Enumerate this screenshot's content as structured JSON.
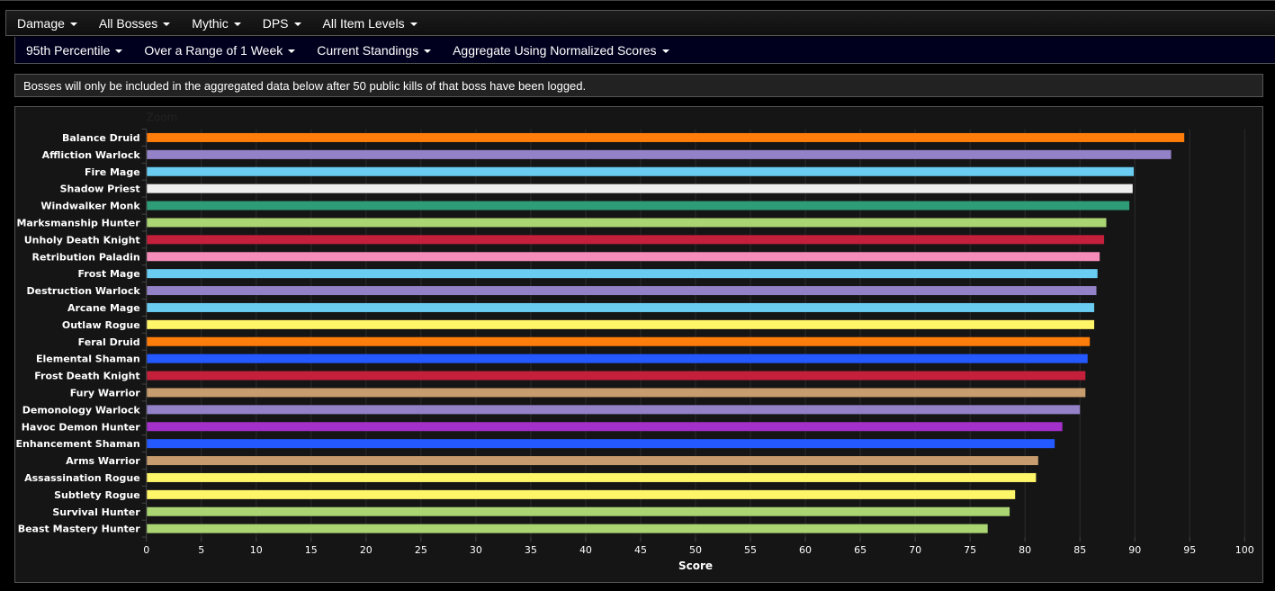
{
  "nav_primary": [
    {
      "label": "Damage"
    },
    {
      "label": "All Bosses"
    },
    {
      "label": "Mythic"
    },
    {
      "label": "DPS"
    },
    {
      "label": "All Item Levels"
    }
  ],
  "nav_secondary": [
    {
      "label": "95th Percentile"
    },
    {
      "label": "Over a Range of 1 Week"
    },
    {
      "label": "Current Standings"
    },
    {
      "label": "Aggregate Using Normalized Scores"
    }
  ],
  "info_message": "Bosses will only be included in the aggregated data below after 50 public kills of that boss have been logged.",
  "chart_data": {
    "type": "bar",
    "orientation": "horizontal",
    "zoom_label": "Zoom",
    "title": "",
    "xlabel": "Score",
    "ylabel": "",
    "xlim": [
      0,
      100
    ],
    "x_ticks": [
      0,
      5,
      10,
      15,
      20,
      25,
      30,
      35,
      40,
      45,
      50,
      55,
      60,
      65,
      70,
      75,
      80,
      85,
      90,
      95,
      100
    ],
    "grid": true,
    "legend": "none",
    "categories": [
      "Balance Druid",
      "Affliction Warlock",
      "Fire Mage",
      "Shadow Priest",
      "Windwalker Monk",
      "Marksmanship Hunter",
      "Unholy Death Knight",
      "Retribution Paladin",
      "Frost Mage",
      "Destruction Warlock",
      "Arcane Mage",
      "Outlaw Rogue",
      "Feral Druid",
      "Elemental Shaman",
      "Frost Death Knight",
      "Fury Warrior",
      "Demonology Warlock",
      "Havoc Demon Hunter",
      "Enhancement Shaman",
      "Arms Warrior",
      "Assassination Rogue",
      "Subtlety Rogue",
      "Survival Hunter",
      "Beast Mastery Hunter"
    ],
    "values": [
      94.5,
      93.3,
      89.9,
      89.8,
      89.5,
      87.4,
      87.2,
      86.8,
      86.6,
      86.5,
      86.3,
      86.3,
      85.9,
      85.7,
      85.5,
      85.5,
      85.0,
      83.4,
      82.7,
      81.2,
      81.0,
      79.1,
      78.6,
      76.6
    ],
    "colors": [
      "#ff7d0a",
      "#9482c9",
      "#69ccf0",
      "#eeeeee",
      "#2e9c77",
      "#abd473",
      "#c41f3b",
      "#f58cba",
      "#69ccf0",
      "#9482c9",
      "#69ccf0",
      "#fff569",
      "#ff7d0a",
      "#2359ff",
      "#c41f3b",
      "#c79c6e",
      "#9482c9",
      "#a330c9",
      "#2359ff",
      "#c79c6e",
      "#fff569",
      "#fff569",
      "#abd473",
      "#abd473"
    ]
  }
}
